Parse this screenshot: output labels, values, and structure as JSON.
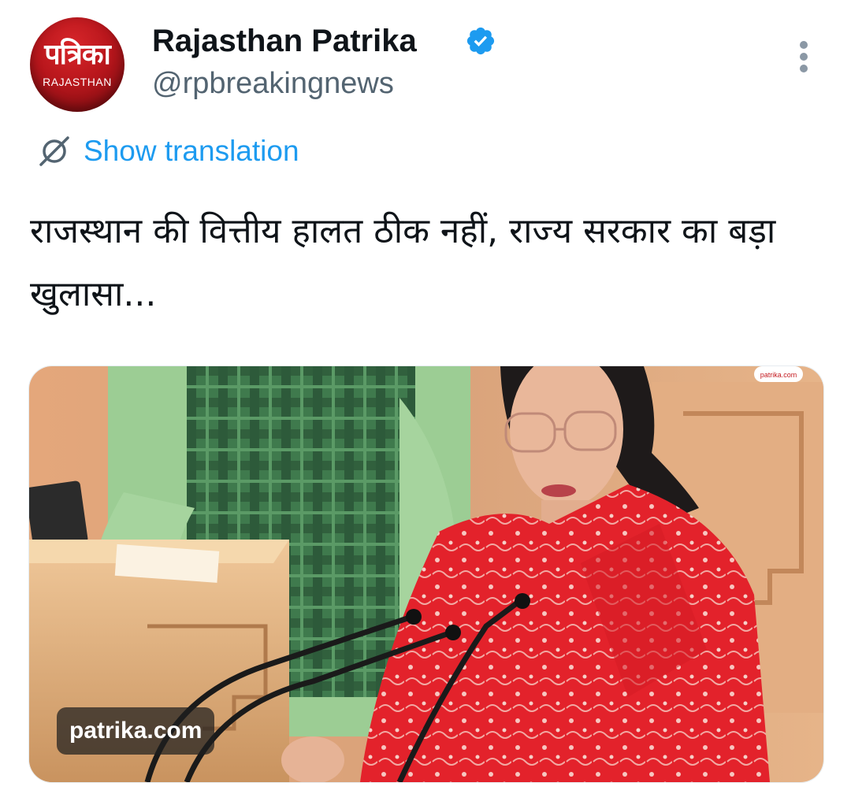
{
  "author": {
    "avatar_logo_main": "पत्रिका",
    "avatar_logo_sub": "RAJASTHAN",
    "display_name": "Rajasthan Patrika",
    "handle": "@rpbreakingnews",
    "verified": true
  },
  "translation": {
    "label": "Show translation"
  },
  "tweet": {
    "text": "राजस्थान की वित्तीय हालत ठीक नहीं, राज्य सरकार का बड़ा खुलासा..."
  },
  "media": {
    "source_label": "patrika.com",
    "watermark": "patrika.com"
  },
  "colors": {
    "link_blue": "#1d9bf0",
    "verified_blue": "#1d9bf0",
    "secondary_text": "#536471",
    "avatar_red": "#c41a20"
  },
  "icons": {
    "verified": "verified-badge-icon",
    "translation": "globe-translate-icon",
    "more": "more-vertical-icon"
  }
}
